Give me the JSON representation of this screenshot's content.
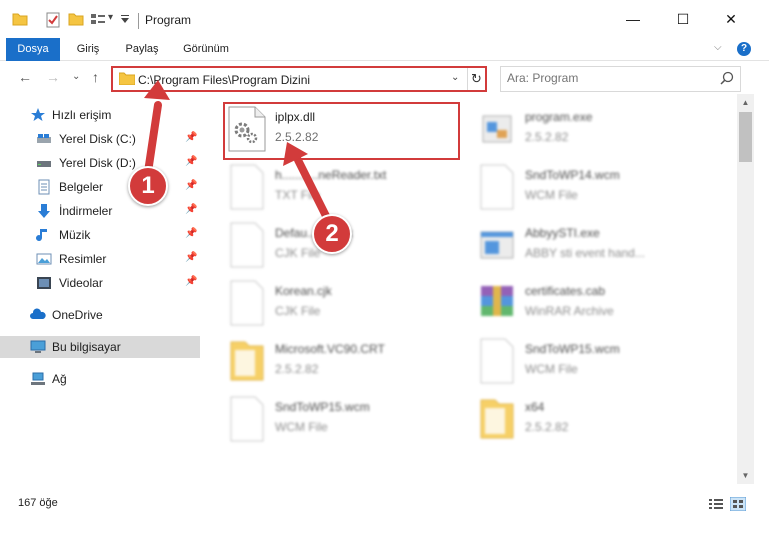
{
  "window": {
    "title": "Program",
    "minimize_glyph": "—",
    "maximize_glyph": "☐",
    "close_glyph": "✕"
  },
  "quick_access": {
    "icons": [
      "folder-icon",
      "checkmark-properties-icon",
      "new-folder-icon",
      "view-options-icon",
      "customize-dropdown-icon"
    ],
    "dropdown_glyph": "▾"
  },
  "ribbon": {
    "tabs": [
      {
        "label": "Dosya"
      },
      {
        "label": "Giriş"
      },
      {
        "label": "Paylaş"
      },
      {
        "label": "Görünüm"
      }
    ],
    "collapse_glyph": "⌵",
    "help_glyph": "?"
  },
  "nav": {
    "back_glyph": "←",
    "forward_glyph": "→",
    "recent_glyph": "⌄",
    "up_glyph": "↑",
    "address": "C:\\Program Files\\Program Dizini",
    "address_dropdown_glyph": "⌄",
    "refresh_glyph": "↻",
    "search_placeholder": "Ara: Program"
  },
  "sidebar": {
    "pin_glyph": "📌",
    "items": [
      {
        "label": "Hızlı erişim",
        "icon": "star-icon"
      },
      {
        "label": "Yerel Disk (C:)",
        "icon": "drive-icon"
      },
      {
        "label": "Yerel Disk (D:)",
        "icon": "drive-icon"
      },
      {
        "label": "Belgeler",
        "icon": "documents-icon"
      },
      {
        "label": "İndirmeler",
        "icon": "download-icon"
      },
      {
        "label": "Müzik",
        "icon": "music-icon"
      },
      {
        "label": "Resimler",
        "icon": "pictures-icon"
      },
      {
        "label": "Videolar",
        "icon": "video-icon"
      },
      {
        "label": "OneDrive",
        "icon": "cloud-icon"
      },
      {
        "label": "Bu bilgisayar",
        "icon": "computer-icon"
      },
      {
        "label": "Ağ",
        "icon": "network-icon"
      }
    ]
  },
  "files": [
    {
      "name": "iplpx.dll",
      "sub": "2.5.2.82",
      "icon": "dll-gear-icon"
    },
    {
      "name": "program.exe",
      "sub": "2.5.2.82",
      "icon": "exe-icon"
    },
    {
      "name": "h...........neReader.txt",
      "sub": "TXT File",
      "icon": "text-file-icon"
    },
    {
      "name": "SndToWP14.wcm",
      "sub": "WCM File",
      "icon": "file-icon"
    },
    {
      "name": "Defau...........jk",
      "sub": "CJK File",
      "icon": "file-icon"
    },
    {
      "name": "AbbyySTI.exe",
      "sub": "ABBY sti event hand...",
      "icon": "exe-window-icon"
    },
    {
      "name": "Korean.cjk",
      "sub": "CJK File",
      "icon": "file-icon"
    },
    {
      "name": "certificates.cab",
      "sub": "WinRAR Archive",
      "icon": "winrar-icon"
    },
    {
      "name": "Microsoft.VC90.CRT",
      "sub": "2.5.2.82",
      "icon": "folder-icon"
    },
    {
      "name": "SndToWP15.wcm",
      "sub": "WCM File",
      "icon": "file-icon"
    },
    {
      "name": "SndToWP15.wcm",
      "sub": "WCM File",
      "icon": "file-icon"
    },
    {
      "name": "x64",
      "sub": "2.5.2.82",
      "icon": "folder-icon"
    }
  ],
  "scrollbar": {
    "up_glyph": "▲",
    "down_glyph": "▼"
  },
  "status": {
    "item_count": "167 öğe"
  },
  "annotations": [
    {
      "label": "1"
    },
    {
      "label": "2"
    }
  ],
  "colors": {
    "accent": "#1a6fc9",
    "highlight": "#d23b3b",
    "folder": "#f5c542"
  }
}
